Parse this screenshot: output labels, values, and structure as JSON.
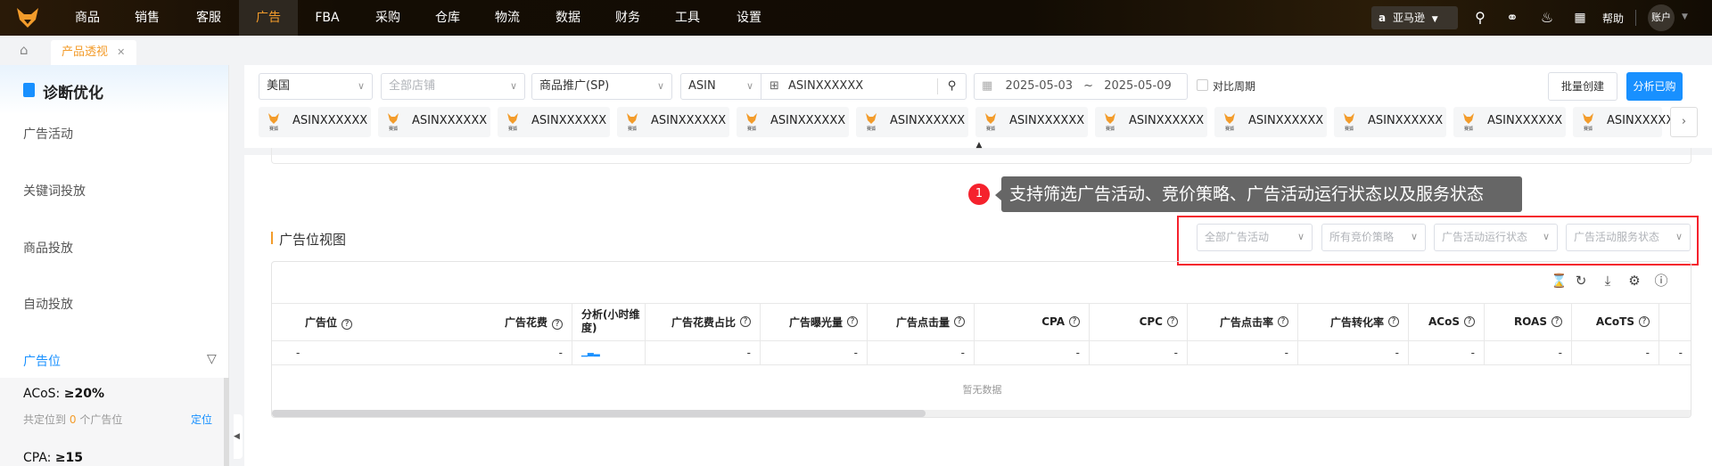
{
  "header": {
    "nav": [
      "商品",
      "销售",
      "客服",
      "广告",
      "FBA",
      "采购",
      "仓库",
      "物流",
      "数据",
      "财务",
      "工具",
      "设置"
    ],
    "active": "广告",
    "platform": "亚马逊",
    "help": "帮助",
    "account": "账户"
  },
  "tabs": {
    "home_icon": "home-icon",
    "items": [
      {
        "label": "产品透视",
        "close": "✕"
      }
    ]
  },
  "sidebar": {
    "title": "诊断优化",
    "items": [
      "广告活动",
      "关键词投放",
      "商品投放",
      "自动投放"
    ],
    "active_section": "广告位",
    "rules": [
      {
        "label": "ACoS: ",
        "value": "≥20%",
        "note_pre": "共定位到",
        "count": "0",
        "note_post": "个广告位",
        "action": "定位"
      },
      {
        "label": "CPA: ",
        "value": "≥15"
      }
    ]
  },
  "filters": {
    "country": "美国",
    "store_placeholder": "全部店铺",
    "ad_type": "商品推广(SP)",
    "search_type": "ASIN",
    "search_value": "ASINXXXXXX",
    "date_start": "2025-05-03",
    "date_sep": "~",
    "date_end": "2025-05-09",
    "compare_label": "对比周期",
    "batch_create": "批量创建",
    "analyze_bought": "分析已购"
  },
  "asin_chips": [
    "ASINXXXXXX",
    "ASINXXXXXX",
    "ASINXXXXXX",
    "ASINXXXXXX",
    "ASINXXXXXX",
    "ASINXXXXXX",
    "ASINXXXXXX",
    "ASINXXXXXX",
    "ASINXXXXXX",
    "ASINXXXXXX",
    "ASINXXXXXX",
    "ASINXXXXX"
  ],
  "chip_badge": "赛狐",
  "tooltip": {
    "step": "1",
    "text": "支持筛选广告活动、竞价策略、广告活动运行状态以及服务状态"
  },
  "section": {
    "title": "广告位视图",
    "filters": [
      "全部广告活动",
      "所有竞价策略",
      "广告活动运行状态",
      "广告活动服务状态"
    ]
  },
  "table": {
    "columns": [
      "广告位",
      "广告花费",
      "分析(小时维度)",
      "广告花费占比",
      "广告曝光量",
      "广告点击量",
      "CPA",
      "CPC",
      "广告点击率",
      "广告转化率",
      "ACoS",
      "ROAS",
      "ACoTS"
    ],
    "row": [
      "-",
      "-",
      "",
      "-",
      "-",
      "-",
      "-",
      "-",
      "-",
      "-",
      "-",
      "-",
      "-",
      "-"
    ],
    "empty": "暂无数据"
  },
  "colors": {
    "accent": "#f39c2b",
    "primary": "#1890ff",
    "highlight": "#f5222d"
  }
}
